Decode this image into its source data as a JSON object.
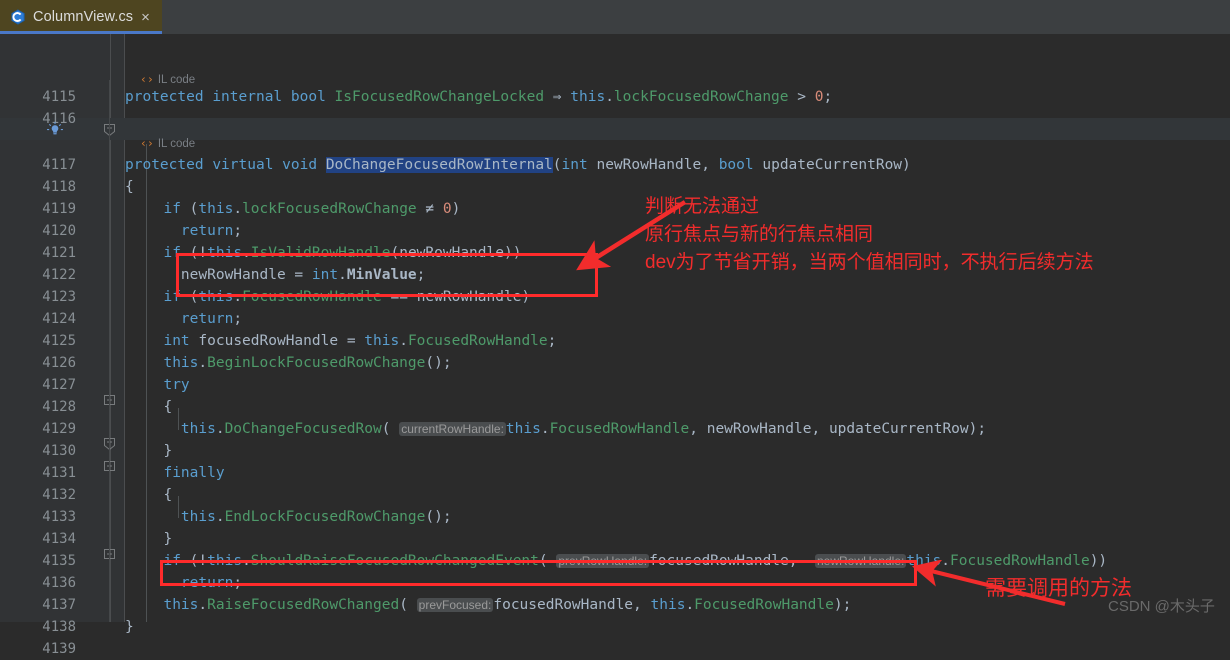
{
  "window": {
    "tab": {
      "label": "ColumnView.cs",
      "icon": "csharp-file-icon",
      "close_glyph": "×"
    }
  },
  "editor": {
    "codelens_label": "IL code",
    "codelens_glyph": "‹›",
    "first_line": 4115,
    "current_line": 4117,
    "lines": [
      {
        "n": 4115,
        "text": "    protected internal bool IsFocusedRowChangeLocked ⇒ this.lockFocusedRowChange > 0;"
      },
      {
        "n": 4116,
        "text": ""
      },
      {
        "n": 4117,
        "text": "    protected virtual void DoChangeFocusedRowInternal(int newRowHandle, bool updateCurrentRow)"
      },
      {
        "n": 4118,
        "text": "    {"
      },
      {
        "n": 4119,
        "text": "      if (this.lockFocusedRowChange ≠ 0)"
      },
      {
        "n": 4120,
        "text": "        return;"
      },
      {
        "n": 4121,
        "text": "      if (!this.IsValidRowHandle(newRowHandle))"
      },
      {
        "n": 4122,
        "text": "        newRowHandle = int.MinValue;"
      },
      {
        "n": 4123,
        "text": "      if (this.FocusedRowHandle == newRowHandle)"
      },
      {
        "n": 4124,
        "text": "        return;"
      },
      {
        "n": 4125,
        "text": "      int focusedRowHandle = this.FocusedRowHandle;"
      },
      {
        "n": 4126,
        "text": "      this.BeginLockFocusedRowChange();"
      },
      {
        "n": 4127,
        "text": "      try"
      },
      {
        "n": 4128,
        "text": "      {"
      },
      {
        "n": 4129,
        "text": "        this.DoChangeFocusedRow( currentRowHandle: this.FocusedRowHandle, newRowHandle, updateCurrentRow);"
      },
      {
        "n": 4130,
        "text": "      }"
      },
      {
        "n": 4131,
        "text": "      finally"
      },
      {
        "n": 4132,
        "text": "      {"
      },
      {
        "n": 4133,
        "text": "        this.EndLockFocusedRowChange();"
      },
      {
        "n": 4134,
        "text": "      }"
      },
      {
        "n": 4135,
        "text": "      if (!this.ShouldRaiseFocusedRowChangedEvent( prevRowHandle: focusedRowHandle,  newRowHandle: this.FocusedRowHandle))"
      },
      {
        "n": 4136,
        "text": "        return;"
      },
      {
        "n": 4137,
        "text": "      this.RaiseFocusedRowChanged( prevFocused: focusedRowHandle, this.FocusedRowHandle);"
      },
      {
        "n": 4138,
        "text": "    }"
      },
      {
        "n": 4139,
        "text": ""
      }
    ],
    "selected_identifier": "DoChangeFocusedRowInternal",
    "parameter_hints": [
      "currentRowHandle:",
      "prevRowHandle:",
      "newRowHandle:",
      "prevFocused:"
    ]
  },
  "annotations": {
    "note1_line1": "判断无法通过",
    "note1_line2": "原行焦点与新的行焦点相同",
    "note1_line3": "dev为了节省开销，当两个值相同时，不执行后续方法",
    "note2": "需要调用的方法",
    "accent_color": "#f22c2c"
  },
  "watermark": {
    "text": "CSDN @木头子"
  }
}
